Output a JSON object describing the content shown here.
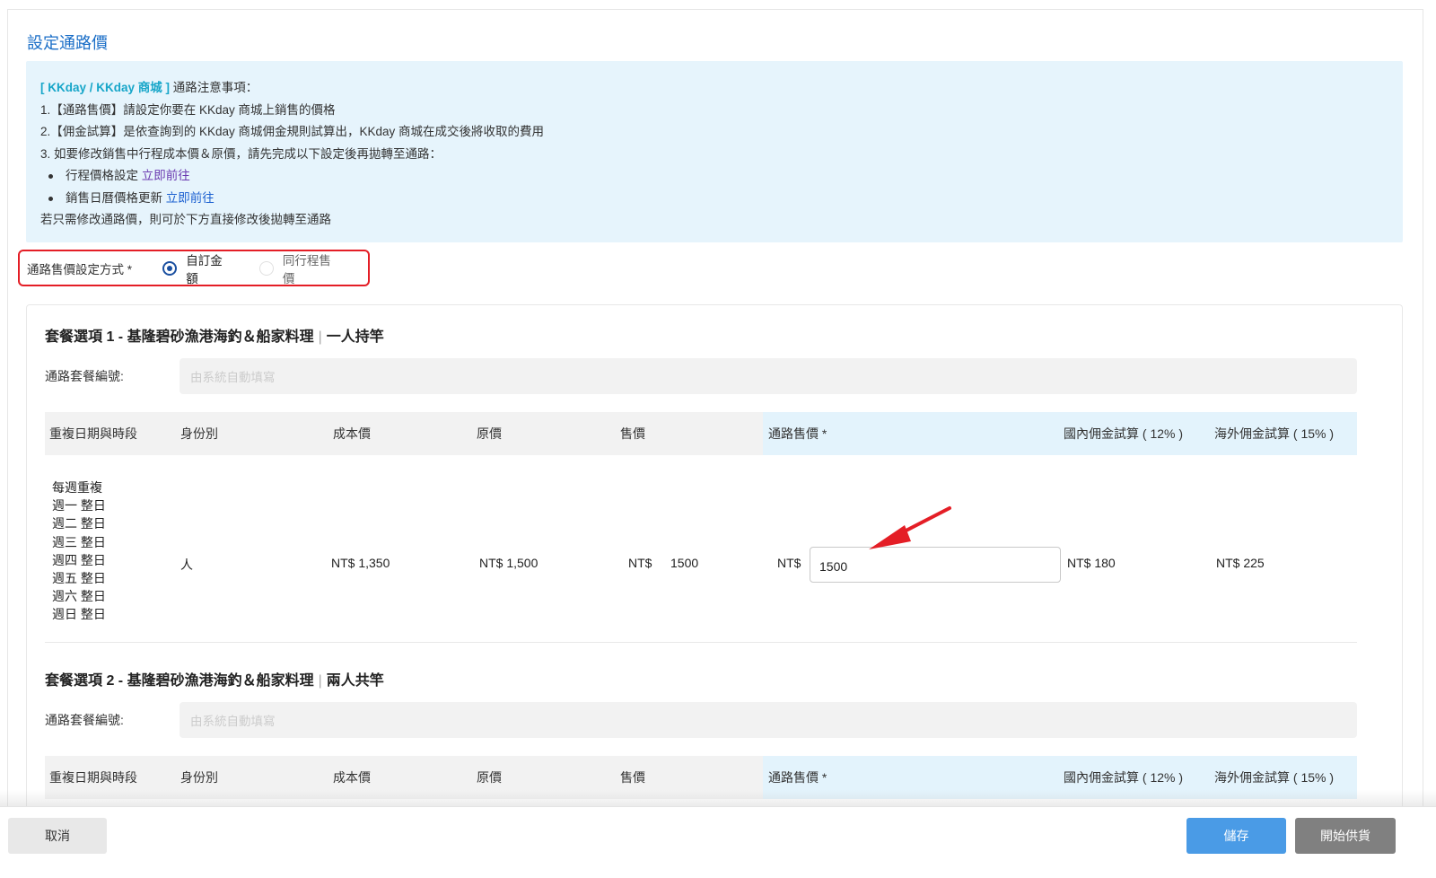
{
  "page_title": "設定通路價",
  "notice": {
    "brand": "[ KKday / KKday 商城 ]",
    "heading_rest": "通路注意事項：",
    "line1": "1.【通路售價】請設定你要在 KKday 商城上銷售的價格",
    "line2": "2.【佣金試算】是依查詢到的 KKday 商城佣金規則試算出，KKday 商城在成交後將收取的費用",
    "line3": "3. 如要修改銷售中行程成本價＆原價，請先完成以下設定後再拋轉至通路：",
    "bullet1_text": "行程價格設定",
    "bullet1_link": "立即前往",
    "bullet2_text": "銷售日曆價格更新",
    "bullet2_link": "立即前往",
    "footer_line": "若只需修改通路價，則可於下方直接修改後拋轉至通路"
  },
  "pricing_mode": {
    "label": "通路售價設定方式 *",
    "options": [
      {
        "label": "自訂金額",
        "checked": true
      },
      {
        "label": "同行程售價",
        "checked": false
      }
    ]
  },
  "table_headers": [
    "重複日期與時段",
    "身份別",
    "成本價",
    "原價",
    "售價",
    "通路售價 *",
    "國內佣金試算 ( 12% )",
    "海外佣金試算 ( 15% )"
  ],
  "packages": [
    {
      "title_prefix": "套餐選項 1 - 基隆碧砂漁港海釣＆船家料理",
      "title_sep": "|",
      "title_suffix": "一人持竿",
      "code_label": "通路套餐編號:",
      "code_placeholder": "由系統自動填寫",
      "row": {
        "days": [
          "每週重複",
          "週一 整日",
          "週二 整日",
          "週三 整日",
          "週四 整日",
          "週五 整日",
          "週六 整日",
          "週日 整日"
        ],
        "identity": "人",
        "cost": "NT$ 1,350",
        "original": "NT$ 1,500",
        "price_currency": "NT$",
        "price_value": "1500",
        "channel_currency": "NT$",
        "channel_value": "1500",
        "domestic_commission": "NT$ 180",
        "overseas_commission": "NT$ 225"
      }
    },
    {
      "title_prefix": "套餐選項 2 - 基隆碧砂漁港海釣＆船家料理",
      "title_sep": "|",
      "title_suffix": "兩人共竿",
      "code_label": "通路套餐編號:",
      "code_placeholder": "由系統自動填寫"
    }
  ],
  "footer": {
    "cancel": "取消",
    "save": "儲存",
    "start_supply": "開始供貨"
  },
  "colors": {
    "accent_blue": "#1a6ec7",
    "annotation_red": "#e41e26",
    "notice_bg": "#e6f4fc",
    "save_btn": "#4a9be6",
    "supply_btn": "#808080"
  }
}
